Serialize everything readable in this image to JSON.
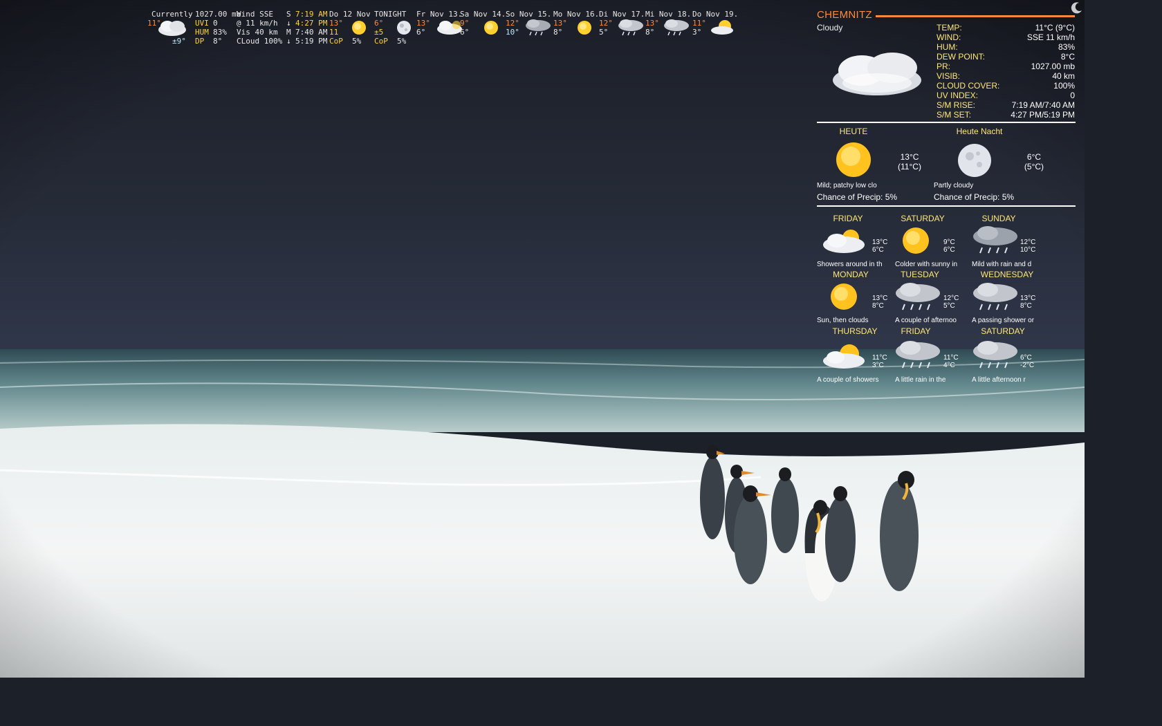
{
  "top_strip": {
    "current": {
      "label": "Currently",
      "temp": "11°",
      "feels": "±9°",
      "pressure": "1027.00 mb",
      "uvi_label": "UVI",
      "uvi": "0",
      "hum_label": "HUM",
      "hum": "83%",
      "dp_label": "DP",
      "dp": "8°",
      "wind_line": "Wind SSE",
      "wind_speed": "@ 11 km/h",
      "vis_line": "Vis 40 km",
      "cloud_line": "CLoud 100%",
      "sun_m": "S",
      "sun_rise": "7:19 AM",
      "sun_set": "4:27 PM",
      "moon_m": "M",
      "moon_rise": "7:40 AM",
      "moon_set": "5:19 PM",
      "up_arrow": "↑",
      "down_arrow": "↓"
    },
    "today": {
      "label": "Do 12 Nov",
      "hi": "13°",
      "lo": "11",
      "cop_label": "CoP",
      "cop": "5%"
    },
    "tonight": {
      "label": "TONIGHT",
      "hi": "6°",
      "lo": "±5",
      "cop_label": "CoP",
      "cop": "5%"
    },
    "days": [
      {
        "label": "Fr  Nov 13.",
        "hi": "13°",
        "lo": "6°",
        "icon": "cloudy-icon"
      },
      {
        "label": "Sa  Nov 14.",
        "hi": "9°",
        "lo": "6°",
        "icon": "sunny-icon"
      },
      {
        "label": "So  Nov 15.",
        "hi": "12°",
        "lo": "10°",
        "icon": "rain-icon"
      },
      {
        "label": "Mo  Nov 16.",
        "hi": "13°",
        "lo": "8°",
        "icon": "sunny-icon"
      },
      {
        "label": "Di  Nov 17.",
        "hi": "12°",
        "lo": "5°",
        "icon": "rain-icon"
      },
      {
        "label": "Mi  Nov 18.",
        "hi": "13°",
        "lo": "8°",
        "icon": "rain-icon"
      },
      {
        "label": "Do  Nov 19.",
        "hi": "11°",
        "lo": "3°",
        "icon": "partly-sunny-icon"
      }
    ]
  },
  "panel": {
    "city": "CHEMNITZ",
    "condition": "Cloudy",
    "stats": [
      {
        "k": "TEMP:",
        "v": "11°C (9°C)"
      },
      {
        "k": "WIND:",
        "v": "SSE 11 km/h"
      },
      {
        "k": "HUM:",
        "v": "83%"
      },
      {
        "k": "DEW POINT:",
        "v": "8°C"
      },
      {
        "k": "PR:",
        "v": "1027.00 mb"
      },
      {
        "k": "VISIB:",
        "v": "40 km"
      },
      {
        "k": "CLOUD COVER:",
        "v": "100%"
      },
      {
        "k": "UV INDEX:",
        "v": "0"
      },
      {
        "k": "S/M RISE:",
        "v": "7:19 AM/7:40 AM"
      },
      {
        "k": "S/M SET:",
        "v": "4:27 PM/5:19 PM"
      }
    ],
    "today": {
      "label": "HEUTE",
      "temp": "13°C",
      "feels": "(11°C)",
      "desc": "Mild; patchy low clo",
      "precip": "Chance of Precip: 5%"
    },
    "tonight": {
      "label": "Heute Nacht",
      "temp": "6°C",
      "feels": "(5°C)",
      "desc": "Partly cloudy",
      "precip": "Chance of Precip: 5%"
    },
    "forecast": [
      {
        "day": "FRIDAY",
        "hi": "13°C",
        "lo": "6°C",
        "desc": "Showers around in th",
        "icon": "cloud-sun-icon"
      },
      {
        "day": "SATURDAY",
        "hi": "9°C",
        "lo": "6°C",
        "desc": "Colder with sunny in",
        "icon": "sunny-icon"
      },
      {
        "day": "SUNDAY",
        "hi": "12°C",
        "lo": "10°C",
        "desc": "Mild with rain and d",
        "icon": "rain-icon"
      },
      {
        "day": "MONDAY",
        "hi": "13°C",
        "lo": "8°C",
        "desc": "Sun, then clouds",
        "icon": "sunny-icon"
      },
      {
        "day": "TUESDAY",
        "hi": "12°C",
        "lo": "5°C",
        "desc": "A couple of afternoo",
        "icon": "rain-icon"
      },
      {
        "day": "WEDNESDAY",
        "hi": "13°C",
        "lo": "8°C",
        "desc": "A passing shower or",
        "icon": "rain-icon"
      },
      {
        "day": "THURSDAY",
        "hi": "11°C",
        "lo": "3°C",
        "desc": "A couple of showers",
        "icon": "cloud-sun-icon"
      },
      {
        "day": "FRIDAY",
        "hi": "11°C",
        "lo": "4°C",
        "desc": "A little rain in the",
        "icon": "rain-icon"
      },
      {
        "day": "SATURDAY",
        "hi": "6°C",
        "lo": "-2°C",
        "desc": "A little afternoon r",
        "icon": "rain-icon"
      }
    ]
  }
}
